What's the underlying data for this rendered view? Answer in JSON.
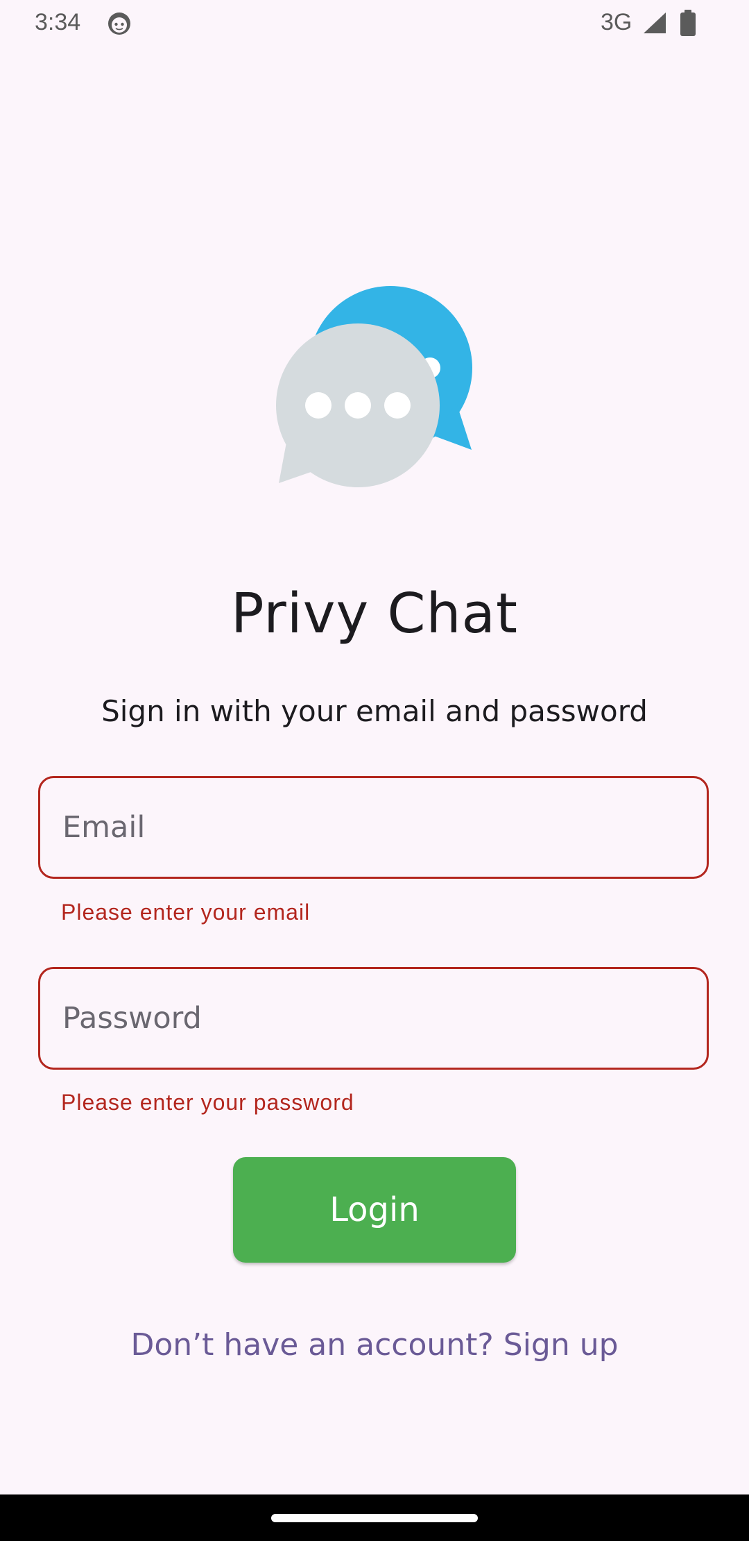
{
  "status_bar": {
    "time": "3:34",
    "network": "3G",
    "icons": [
      "face-icon",
      "signal-icon",
      "battery-icon"
    ]
  },
  "app": {
    "title": "Privy Chat",
    "subtitle": "Sign in with your email and password",
    "logo_icon": "chat-bubbles-icon"
  },
  "form": {
    "email": {
      "placeholder": "Email",
      "value": "",
      "error": "Please enter your email"
    },
    "password": {
      "placeholder": "Password",
      "value": "",
      "error": "Please enter your password"
    },
    "login_label": "Login",
    "signup_prompt": "Don’t have an account? Sign up"
  },
  "colors": {
    "background": "#FCF5FB",
    "error": "#B3261E",
    "button": "#4CAF50",
    "link": "#6A5A96",
    "bubble_blue": "#33B4E6",
    "bubble_gray": "#D5DBDE"
  }
}
